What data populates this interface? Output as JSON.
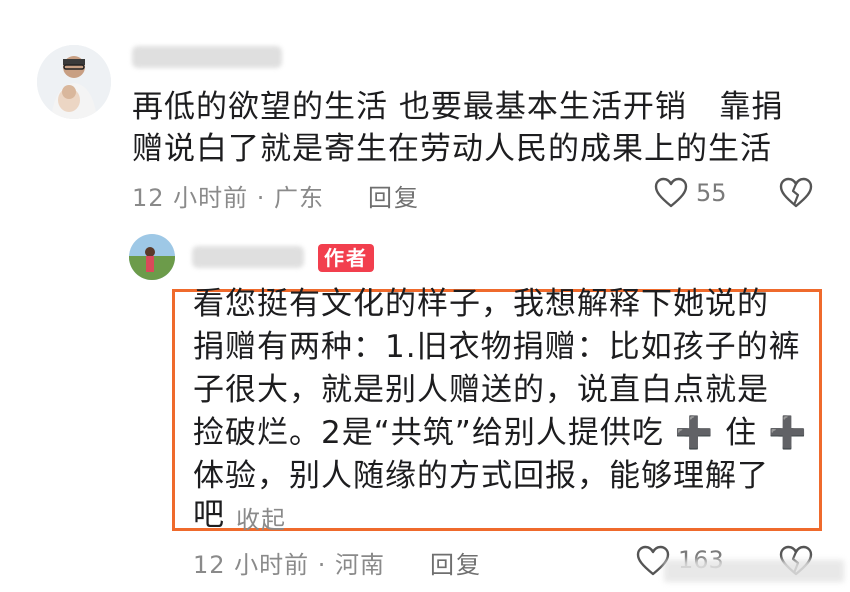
{
  "comment1": {
    "text_line1": "再低的欲望的生活 也要最基本生活开销   靠捐",
    "text_line2": "赠说白了就是寄生在劳动人民的成果上的生活",
    "meta": "12 小时前 · 广东",
    "reply_label": "回复",
    "like_count": "55",
    "icons": {
      "like": "heart-icon",
      "dislike": "broken-heart-icon"
    }
  },
  "reply1": {
    "badge": "作者",
    "text_lines": [
      "看您挺有文化的样子，我想解释下她说的",
      "捐赠有两种：1.旧衣物捐赠：比如孩子的裤",
      "子很大，就是别人赠送的，说直白点就是",
      "捡破烂。2是“共筑”给别人提供吃 ➕ 住 ➕",
      "体验，别人随缘的方式回报，能够理解了",
      "吧"
    ],
    "fold_label": "收起",
    "meta": "12 小时前 · 河南",
    "reply_label": "回复",
    "like_count": "163",
    "accent_color": "#ef6a2c",
    "badge_color": "#f23f4e"
  }
}
